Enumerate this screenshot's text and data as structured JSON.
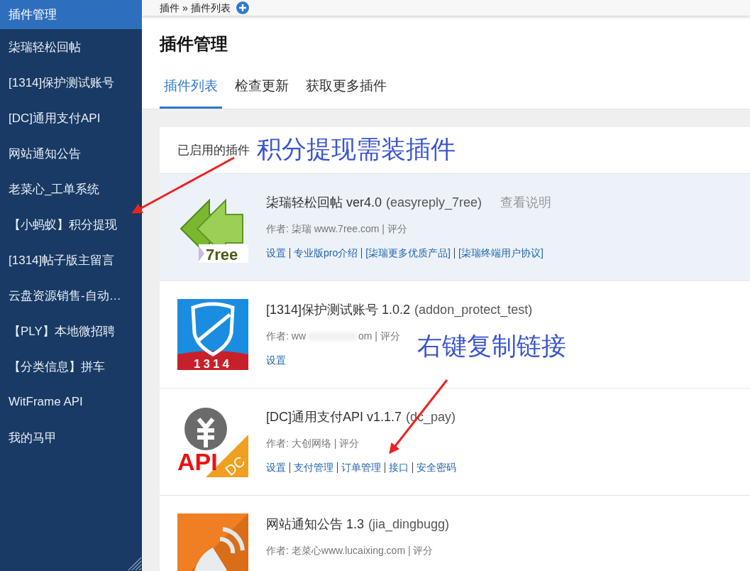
{
  "sidebar": {
    "items": [
      {
        "label": "插件管理",
        "selected": true
      },
      {
        "label": "柒瑞轻松回帖",
        "selected": false
      },
      {
        "label": "[1314]保护测试账号",
        "selected": false
      },
      {
        "label": "[DC]通用支付API",
        "selected": false
      },
      {
        "label": "网站通知公告",
        "selected": false
      },
      {
        "label": "老菜心_工单系统",
        "selected": false
      },
      {
        "label": "【小蚂蚁】积分提现",
        "selected": false
      },
      {
        "label": "[1314]帖子版主留言",
        "selected": false
      },
      {
        "label": "云盘资源销售-自动…",
        "selected": false
      },
      {
        "label": "【PLY】本地微招聘",
        "selected": false
      },
      {
        "label": "【分类信息】拼车",
        "selected": false
      },
      {
        "label": "WitFrame API",
        "selected": false
      },
      {
        "label": "我的马甲",
        "selected": false
      }
    ]
  },
  "breadcrumb": "插件 » 插件列表",
  "title": "插件管理",
  "tabs": [
    {
      "label": "插件列表",
      "selected": true
    },
    {
      "label": "检查更新",
      "selected": false
    },
    {
      "label": "获取更多插件",
      "selected": false
    }
  ],
  "section_title": "已启用的插件",
  "plugins": [
    {
      "kind": "arrows",
      "icon_texts": [
        "7ree"
      ],
      "highlighted": true,
      "name": "柒瑞轻松回帖 ver4.0",
      "identifier": "(easyreply_7ree)",
      "help": "查看说明",
      "author": [
        "作者: 柒瑞 www.7ree.com | 评分"
      ],
      "links": [
        "设置",
        "专业版pro介绍",
        "[柒瑞更多优质产品]",
        "[柒瑞终端用户协议]"
      ]
    },
    {
      "kind": "shield",
      "icon_texts": [
        "1314"
      ],
      "highlighted": false,
      "name": "[1314]保护测试账号 1.0.2",
      "identifier": "(addon_protect_test)",
      "author": [
        "作者: ww",
        "om | 评分"
      ],
      "links": [
        "设置"
      ]
    },
    {
      "kind": "payment",
      "icon_texts": [
        "API",
        "DC"
      ],
      "highlighted": false,
      "name": "[DC]通用支付API v1.1.7",
      "identifier": "(dc_pay)",
      "author": [
        "作者: 大创网络 | 评分"
      ],
      "links": [
        "设置",
        "支付管理",
        "订单管理",
        "接口",
        "安全密码"
      ]
    },
    {
      "kind": "broadcast",
      "highlighted": false,
      "name": "网站通知公告 1.3",
      "identifier": "(jia_dingbugg)",
      "author": [
        "作者: 老菜心www.lucaixing.com | 评分"
      ]
    }
  ],
  "annotations": [
    {
      "text": "积分提现需装插件"
    },
    {
      "text": "右键复制链接"
    }
  ]
}
